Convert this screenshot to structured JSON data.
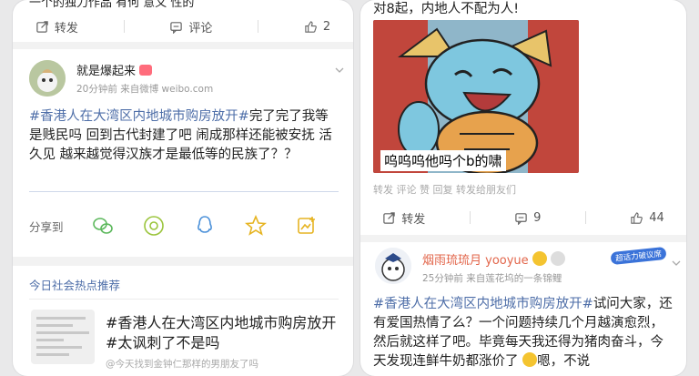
{
  "left": {
    "top_cut_text": "一个的独力作品 有何 意义 性的",
    "top_actions": {
      "repost": "转发",
      "comment": "评论",
      "like": "2"
    },
    "post": {
      "username": "就是爆起来",
      "meta": "20分钟前  来自微博 weibo.com",
      "hashtag": "#香港人在大湾区内地城市购房放开#",
      "text": "完了完了我等是贱民吗 回到古代封建了吧 闹成那样还能被安抚 活久见 越来越觉得汉族才是最低等的民族了？？"
    },
    "share": {
      "label": "分享到"
    },
    "hot": {
      "title": "今日社会热点推荐",
      "hashtag": "#香港人在大湾区内地城市购房放开#",
      "tail": "太讽刺了不是吗",
      "sub": "@今天找到金钟仁那样的男朋友了吗"
    }
  },
  "right": {
    "top_cut_text": "对8起，内地人不配为人!",
    "meme_caption": "呜呜呜他吗个b的啸",
    "fwd_line": "转发 评论 赞 回复  转发给朋友们",
    "actions": {
      "repost": "转发",
      "comment": "9",
      "like": "44"
    },
    "post": {
      "username": "烟雨琉琉月 yooyue",
      "meta": "25分钟前  来自莲花坞的一条锦鲤",
      "badge": "超话力破议席",
      "hashtag": "#香港人在大湾区内地城市购房放开#",
      "text": "试问大家，还有爱国热情了么？一个问题持续几个月越演愈烈，然后就这样了吧。毕竟每天我还得为猪肉奋斗，今天发现连鲜牛奶都涨价了",
      "text_end": "嗯，不说"
    }
  }
}
